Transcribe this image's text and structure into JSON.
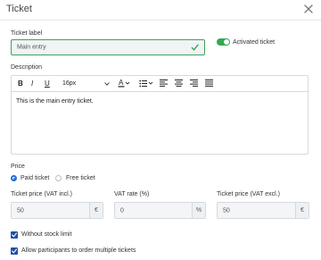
{
  "dialog": {
    "title": "Ticket"
  },
  "ticket_label": {
    "label": "Ticket label",
    "value": "Main entry"
  },
  "activated": {
    "label": "Activated ticket",
    "on": true
  },
  "description": {
    "label": "Description",
    "font_size": "16px",
    "body": "This is the main entry ticket."
  },
  "price": {
    "label": "Price",
    "paid_label": "Paid ticket",
    "free_label": "Free ticket",
    "selected": "paid"
  },
  "fields": {
    "incl_label": "Ticket price (VAT incl.)",
    "incl_value": "50",
    "incl_suffix": "€",
    "vat_label": "VAT rate (%)",
    "vat_value": "0",
    "vat_suffix": "%",
    "excl_label": "Ticket price (VAT excl.)",
    "excl_value": "50",
    "excl_suffix": "€"
  },
  "options": {
    "stock_label": "Without stock limit",
    "multiple_label": "Allow participants to order multiple tickets"
  },
  "colors": {
    "accent": "#1f6ed4",
    "success": "#34a853",
    "checkbox": "#1f4fa8"
  }
}
